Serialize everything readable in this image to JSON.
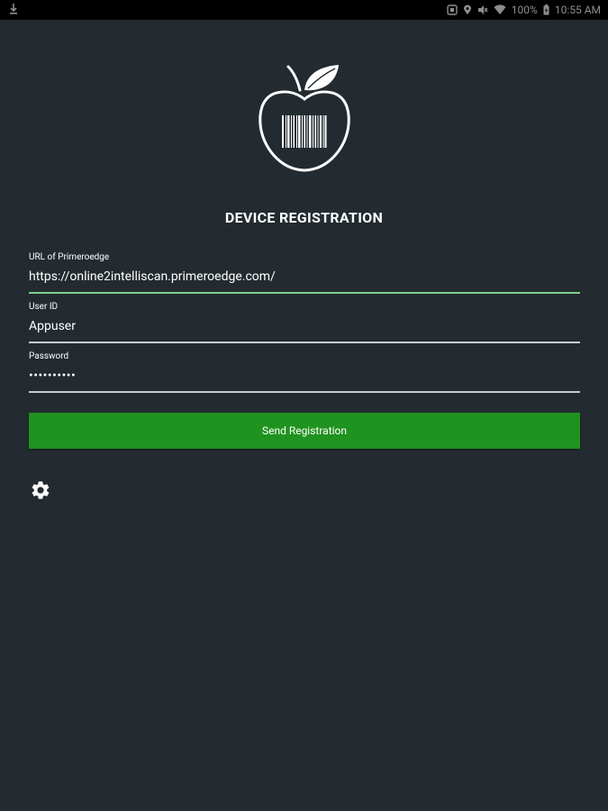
{
  "status_bar": {
    "battery_percent": "100%",
    "time": "10:55 AM",
    "icons": [
      "download-icon",
      "nfc-icon",
      "location-icon",
      "mute-icon",
      "wifi-icon",
      "battery-charging-icon"
    ]
  },
  "logo": {
    "icon": "apple-barcode-logo-icon"
  },
  "title": "DEVICE REGISTRATION",
  "form": {
    "url": {
      "label": "URL of Primeroedge",
      "value": "https://online2intelliscan.primeroedge.com/"
    },
    "user_id": {
      "label": "User ID",
      "value": "Appuser"
    },
    "password": {
      "label": "Password",
      "masked_value": "••••••••••"
    }
  },
  "send_button_label": "Send Registration",
  "settings_icon": "gear-icon",
  "colors": {
    "background": "#232b30",
    "accent_green": "#20921f",
    "active_underline": "#7ed18a",
    "status_bar": "#000000"
  }
}
